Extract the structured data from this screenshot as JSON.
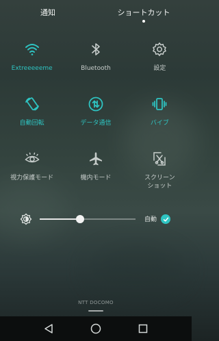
{
  "tabs": [
    {
      "label": "通知",
      "active": false
    },
    {
      "label": "ショートカット",
      "active": true
    }
  ],
  "tiles": [
    {
      "label": "Extreeeeeme",
      "icon": "wifi-icon",
      "active": true
    },
    {
      "label": "Bluetooth",
      "icon": "bluetooth-icon",
      "active": false
    },
    {
      "label": "設定",
      "icon": "gear-icon",
      "active": false
    },
    {
      "label": "自動回転",
      "icon": "auto-rotate-icon",
      "active": true
    },
    {
      "label": "データ通信",
      "icon": "data-transfer-icon",
      "active": true
    },
    {
      "label": "バイブ",
      "icon": "vibrate-icon",
      "active": true
    },
    {
      "label": "視力保護モード",
      "icon": "eye-icon",
      "active": false
    },
    {
      "label": "機内モード",
      "icon": "airplane-icon",
      "active": false
    },
    {
      "label": "スクリーン\nショット",
      "icon": "screenshot-icon",
      "active": false
    }
  ],
  "brightness": {
    "level_percent": 42,
    "auto_label": "自動",
    "auto_enabled": true
  },
  "carrier": "NTT DOCOMO",
  "navigation": {
    "buttons": [
      "back-icon",
      "home-icon",
      "recents-icon"
    ]
  },
  "colors": {
    "accent": "#2ec4c2",
    "inactive": "#c7cdcb"
  }
}
